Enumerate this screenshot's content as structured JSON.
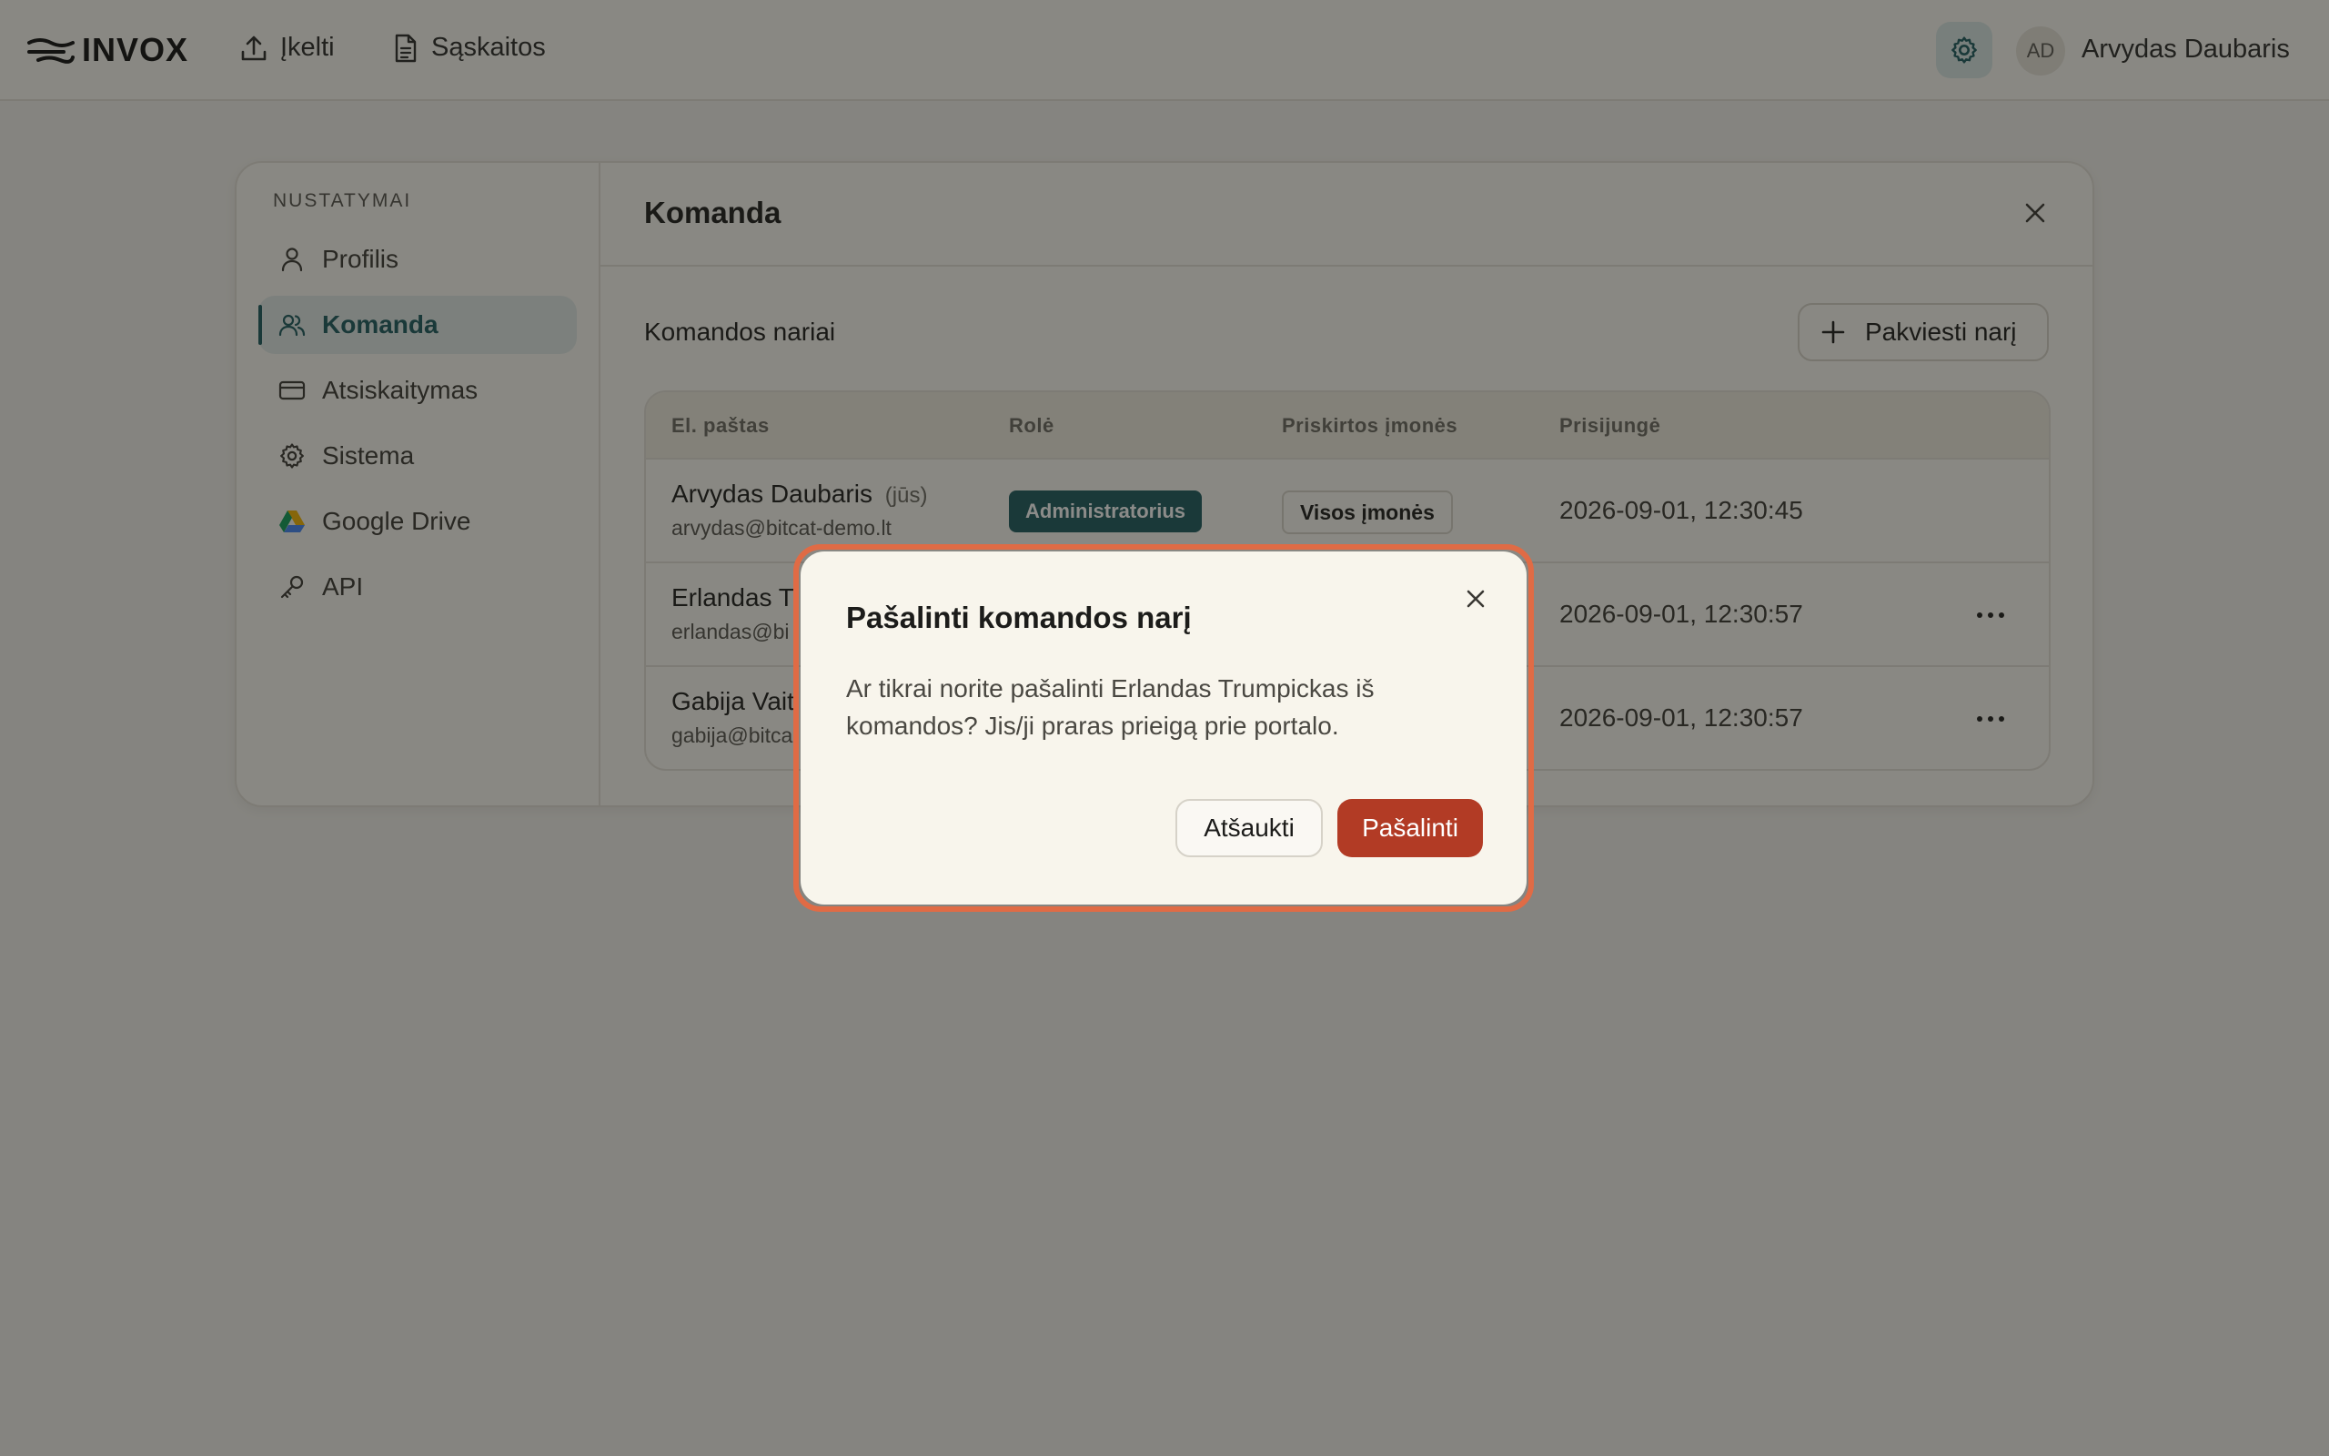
{
  "app": {
    "logo": "INVOX"
  },
  "nav": {
    "upload": "Įkelti",
    "invoices": "Sąskaitos"
  },
  "user": {
    "initials": "AD",
    "name": "Arvydas Daubaris"
  },
  "settings": {
    "title": "NUSTATYMAI",
    "items": [
      {
        "label": "Profilis",
        "icon": "user-icon"
      },
      {
        "label": "Komanda",
        "icon": "users-icon",
        "active": true
      },
      {
        "label": "Atsiskaitymas",
        "icon": "credit-card-icon"
      },
      {
        "label": "Sistema",
        "icon": "gear-icon"
      },
      {
        "label": "Google Drive",
        "icon": "google-drive-icon"
      },
      {
        "label": "API",
        "icon": "key-icon"
      }
    ]
  },
  "team": {
    "title": "Komanda",
    "section": "Komandos nariai",
    "invite_label": "Pakviesti narį",
    "columns": [
      "El. paštas",
      "Rolė",
      "Priskirtos įmonės",
      "Prisijungė"
    ],
    "rows": [
      {
        "name": "Arvydas Daubaris",
        "you": "(jūs)",
        "email": "arvydas@bitcat-demo.lt",
        "role": "Administratorius",
        "companies": "Visos įmonės",
        "joined": "2026-09-01, 12:30:45"
      },
      {
        "name": "Erlandas T",
        "email": "erlandas@bi",
        "joined": "2026-09-01, 12:30:57"
      },
      {
        "name": "Gabija Vait",
        "email": "gabija@bitca",
        "joined": "2026-09-01, 12:30:57"
      }
    ]
  },
  "dialog": {
    "title": "Pašalinti komandos narį",
    "message": "Ar tikrai norite pašalinti Erlandas Trumpickas iš komandos? Jis/ji praras prieigą prie portalo.",
    "cancel": "Atšaukti",
    "confirm": "Pašalinti"
  },
  "colors": {
    "accent": "#1d5a5e",
    "danger": "#b23b25",
    "highlight": "#e06b45"
  }
}
